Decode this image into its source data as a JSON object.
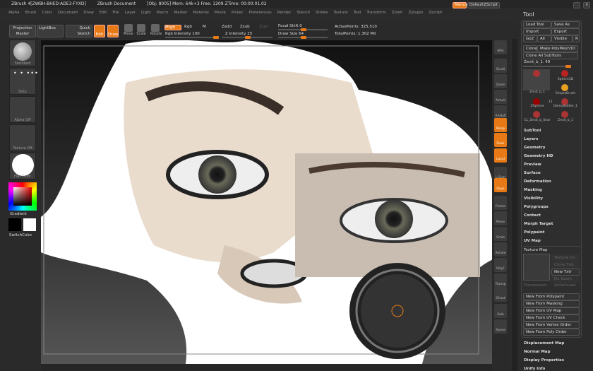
{
  "title": {
    "app": "ZBrush 4[ZWBH-BHED-ADE3-FYXD]",
    "doc": "ZBrush Document",
    "stats": "[Obj: 8005] Mem: 64k+3 Free: 1209 ZTime: 00:00:01.02"
  },
  "menus": [
    "Alpha",
    "Brush",
    "Color",
    "Document",
    "Draw",
    "Edit",
    "File",
    "Layer",
    "Light",
    "Macro",
    "Marker",
    "Material",
    "Movie",
    "Picker",
    "Preferences",
    "Render",
    "Stencil",
    "Stroke",
    "Texture",
    "Tool",
    "Transform",
    "Zoom",
    "Zplugin",
    "Zscript"
  ],
  "titlebar_buttons": {
    "menus": "Menus",
    "script": "DefaultZScript"
  },
  "shelf": {
    "projection_master": "Projection Master",
    "lightbox": "LightBox",
    "quick_sketch": "Quick Sketch",
    "edit": "Edit",
    "draw": "Draw",
    "move": "Move",
    "scale": "Scale",
    "rotate": "Rotate",
    "mrgb": "Mrgb",
    "rgb": "Rgb",
    "m": "M",
    "rgb_intensity": "Rgb Intensity 100",
    "zadd": "Zadd",
    "zsub": "Zsub",
    "zcut": "Zcut",
    "z_intensity": "Z Intensity 25",
    "focal_shift": "Focal Shift 0",
    "draw_size": "Draw Size 64",
    "active_points": "ActivePoints: 325,510",
    "total_points": "TotalPoints: 1.302 Mil"
  },
  "sliders": {
    "rgb_intensity": 100,
    "z_intensity": 25,
    "focal_shift": 0,
    "draw_size": 64
  },
  "left": {
    "brush": "Standard",
    "stroke": "Dots",
    "alpha": "Alpha Off",
    "texture": "Texture Off",
    "material": "Flat Color",
    "gradient": "Gradient",
    "switch": "SwitchColor"
  },
  "right": [
    "SPix",
    "Scroll",
    "Zoom",
    "Actual",
    "AAHalf",
    "Persp",
    "Floor",
    "Local",
    "L.Sym",
    "Qxyz",
    "Frame",
    "Move",
    "Scale",
    "Rotate",
    "PolyF",
    "Transp",
    "Ghost",
    "Solo",
    "Xpose"
  ],
  "tool": {
    "title": "Tool",
    "load": "Load Tool",
    "save": "Save As",
    "import": "Import",
    "export": "Export",
    "goz": "GoZ",
    "all": "All",
    "visible": "Visible",
    "r": "R",
    "clone": "Clone",
    "make_poly": "Make PolyMesh3D",
    "clone_all": "Clone All SubTools",
    "current": "Zenit_b_1. 49",
    "thumbs": [
      "Zenit_b_1",
      "Sphere3D",
      "SimpleBrush",
      "ZSphere",
      "DemoSoldier_1",
      "CL_Zenit_b_Sear",
      "Zenit_b_1"
    ],
    "count": "11",
    "sections": [
      "SubTool",
      "Layers",
      "Geometry",
      "Geometry HD",
      "Preview",
      "Surface",
      "Deformation",
      "Masking",
      "Visibility",
      "Polygroups",
      "Contact",
      "Morph Target",
      "Polypaint",
      "UV Map"
    ],
    "texture_map": "Texture Map",
    "tex_buttons": [
      "Texture On",
      "Clone Txtr",
      "New Txtr",
      "Fix Seam"
    ],
    "transparent": "Transparent",
    "antialiased": "Antialiased",
    "new_from": [
      "New From Polypaint",
      "New From Masking",
      "New From UV Map",
      "New From UV Check",
      "New From Vertex Order",
      "New From Poly Order"
    ],
    "bottom_sections": [
      "Displacement Map",
      "Normal Map",
      "Display Properties",
      "Unify Info"
    ]
  },
  "colors": {
    "accent": "#e77a16",
    "panel": "#2b2b2b"
  }
}
